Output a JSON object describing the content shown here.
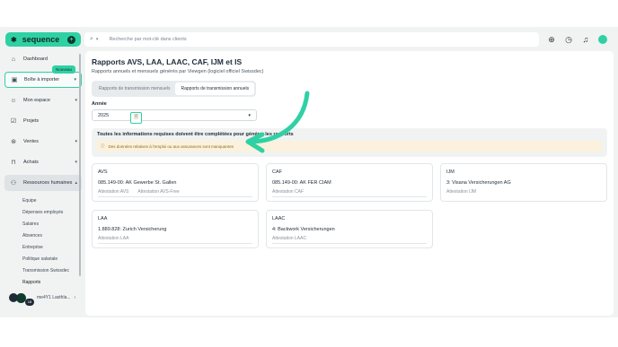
{
  "app": {
    "logo_text": "sequence",
    "search_placeholder": "Recherche par mot-clé dans clients"
  },
  "sidebar": {
    "items": [
      {
        "label": "Dashboard",
        "icon": "home-icon"
      },
      {
        "label": "Boîte à importer",
        "icon": "inbox-icon",
        "badge": "Nouveau"
      },
      {
        "label": "Mon espace",
        "icon": "user-icon"
      },
      {
        "label": "Projets",
        "icon": "check-square-icon"
      },
      {
        "label": "Ventes",
        "icon": "tag-icon"
      },
      {
        "label": "Achats",
        "icon": "bag-icon"
      },
      {
        "label": "Ressources humaines",
        "icon": "people-icon"
      }
    ],
    "sub_items": [
      "Equipe",
      "Dépenses employés",
      "Salaires",
      "Absences",
      "Entreprise",
      "Politique salariale",
      "Transmission Swissdec",
      "Rapports"
    ],
    "user": {
      "count": "18",
      "name": "me4Y1 Lasthla..."
    }
  },
  "main": {
    "title": "Rapports AVS, LAA, LAAC, CAF, IJM et IS",
    "subtitle": "Rapports annuels et mensuels générés par Viewgen (logiciel officiel Swissdec)",
    "tabs": [
      "Rapports de transmission mensuels",
      "Rapports de transmission annuels"
    ],
    "year_label": "Année",
    "year_value": "2025",
    "info_title": "Toutes les informations requises doivent être complétées pour générer les rapports",
    "warning_text": "Des données relatives à l'emploi ou aux assurances sont manquantes",
    "cards": [
      {
        "title": "AVS",
        "row": "085.149-00:  AK Gewerbe St. Gallen",
        "links": [
          "Attestation AVS",
          "Attestation AVS-Free"
        ]
      },
      {
        "title": "CAF",
        "row": "085.149-00:  AK FER CIAM",
        "links": [
          "Attestation CAF"
        ]
      },
      {
        "title": "IJM",
        "row": "3:  Visana Versicherungen AG",
        "links": [
          "Attestation IJM"
        ]
      },
      {
        "title": "LAA",
        "row": "1.889.828:  Zurich Versicherung",
        "links": [
          "Attestation LAA"
        ]
      },
      {
        "title": "LAAC",
        "row": "4:  Backwork Versicherungen",
        "links": [
          "Attestation LAAC"
        ]
      }
    ]
  },
  "colors": {
    "accent": "#2fd1a4",
    "warning_bg": "#fbf1dc",
    "warning_text": "#8a6d1a"
  }
}
